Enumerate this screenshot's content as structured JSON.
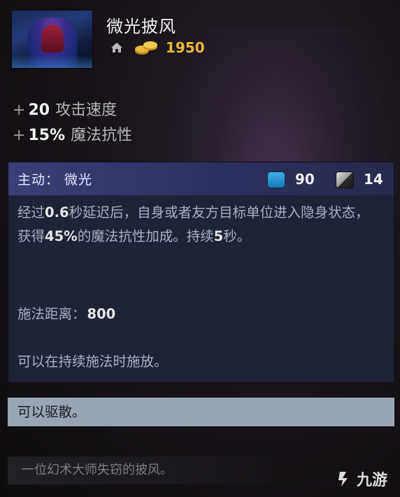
{
  "item": {
    "name": "微光披风",
    "gold_cost": "1950"
  },
  "stats": [
    {
      "plus": "+",
      "value": "20",
      "label": "攻击速度"
    },
    {
      "plus": "+",
      "value": "15%",
      "label": "魔法抗性"
    }
  ],
  "ability": {
    "title": "主动：  微光",
    "mana_cost": "90",
    "cooldown": "14",
    "desc_parts": {
      "p1": "经过",
      "v1": "0.6",
      "p2": "秒延迟后，自身或者友方目标单位进入隐身状态， 获得",
      "v2": "45%",
      "p3": "的魔法抗性加成。持续",
      "v3": "5",
      "p4": "秒。"
    },
    "cast_range_label": "施法距离：",
    "cast_range_value": "800",
    "cast_note": "可以在持续施法时施放。"
  },
  "dispel": "可以驱散。",
  "lore": "一位幻术大师失窃的披风。",
  "watermark": "九游",
  "colors": {
    "gold": "#e9b93c",
    "ability_header": "#3a3f78",
    "mana": "#2a94d4",
    "dispel_bar": "#98a5b2"
  }
}
